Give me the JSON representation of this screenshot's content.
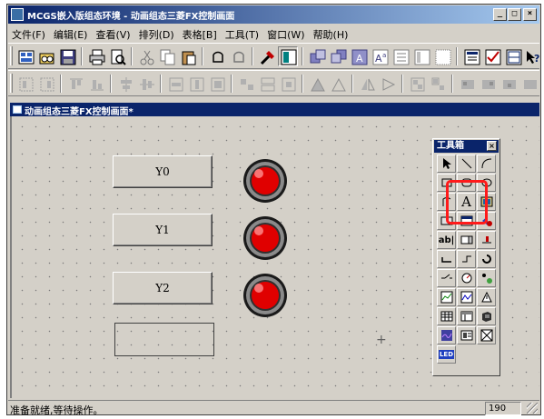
{
  "window": {
    "title": "MCGS嵌入版组态环境 - 动画组态三菱FX控制画面",
    "buttons": {
      "minimize": "_",
      "maximize": "□",
      "close": "×"
    }
  },
  "menu": {
    "items": [
      "文件(F)",
      "编辑(E)",
      "查看(V)",
      "排列(D)",
      "表格[B]",
      "工具(T)",
      "窗口(W)",
      "帮助(H)"
    ]
  },
  "child_window": {
    "title": "动画组态三菱FX控制画面*"
  },
  "canvas": {
    "buttons": [
      {
        "label": "Y0"
      },
      {
        "label": "Y1"
      },
      {
        "label": "Y2"
      }
    ],
    "lamps": [
      {
        "color": "#e00000"
      },
      {
        "color": "#e00000"
      },
      {
        "color": "#e00000"
      }
    ]
  },
  "toolbox": {
    "title": "工具箱",
    "close": "×",
    "label_tool_glyph": "A",
    "textbox_tool_glyph": "ab|",
    "led_tool_glyph": "LED"
  },
  "statusbar": {
    "text": "准备就绪,等待操作。",
    "value": "190"
  },
  "colors": {
    "titlebar": "#0a246a",
    "face": "#d4d0c8",
    "highlight_box": "#ff1a1a"
  }
}
